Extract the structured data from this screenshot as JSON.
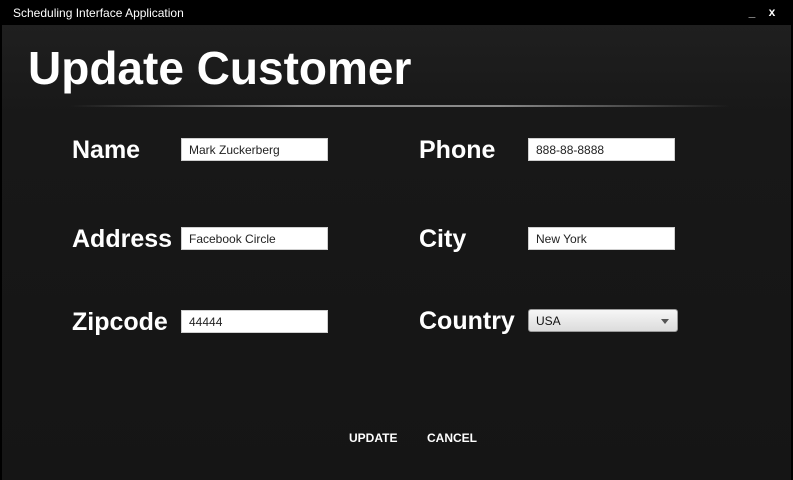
{
  "window": {
    "title": "Scheduling Interface Application",
    "minimize_label": "_",
    "close_label": "x"
  },
  "page": {
    "heading": "Update Customer"
  },
  "form": {
    "name": {
      "label": "Name",
      "value": "Mark Zuckerberg"
    },
    "phone": {
      "label": "Phone",
      "value": "888-88-8888"
    },
    "address": {
      "label": "Address",
      "value": "Facebook Circle"
    },
    "city": {
      "label": "City",
      "value": "New York"
    },
    "zipcode": {
      "label": "Zipcode",
      "value": "44444"
    },
    "country": {
      "label": "Country",
      "value": "USA"
    }
  },
  "actions": {
    "update_label": "UPDATE",
    "cancel_label": "CANCEL"
  },
  "icons": {
    "dropdown": "chevron-down-icon"
  },
  "colors": {
    "background": "#151515",
    "text": "#ffffff",
    "field_bg": "#ffffff"
  }
}
